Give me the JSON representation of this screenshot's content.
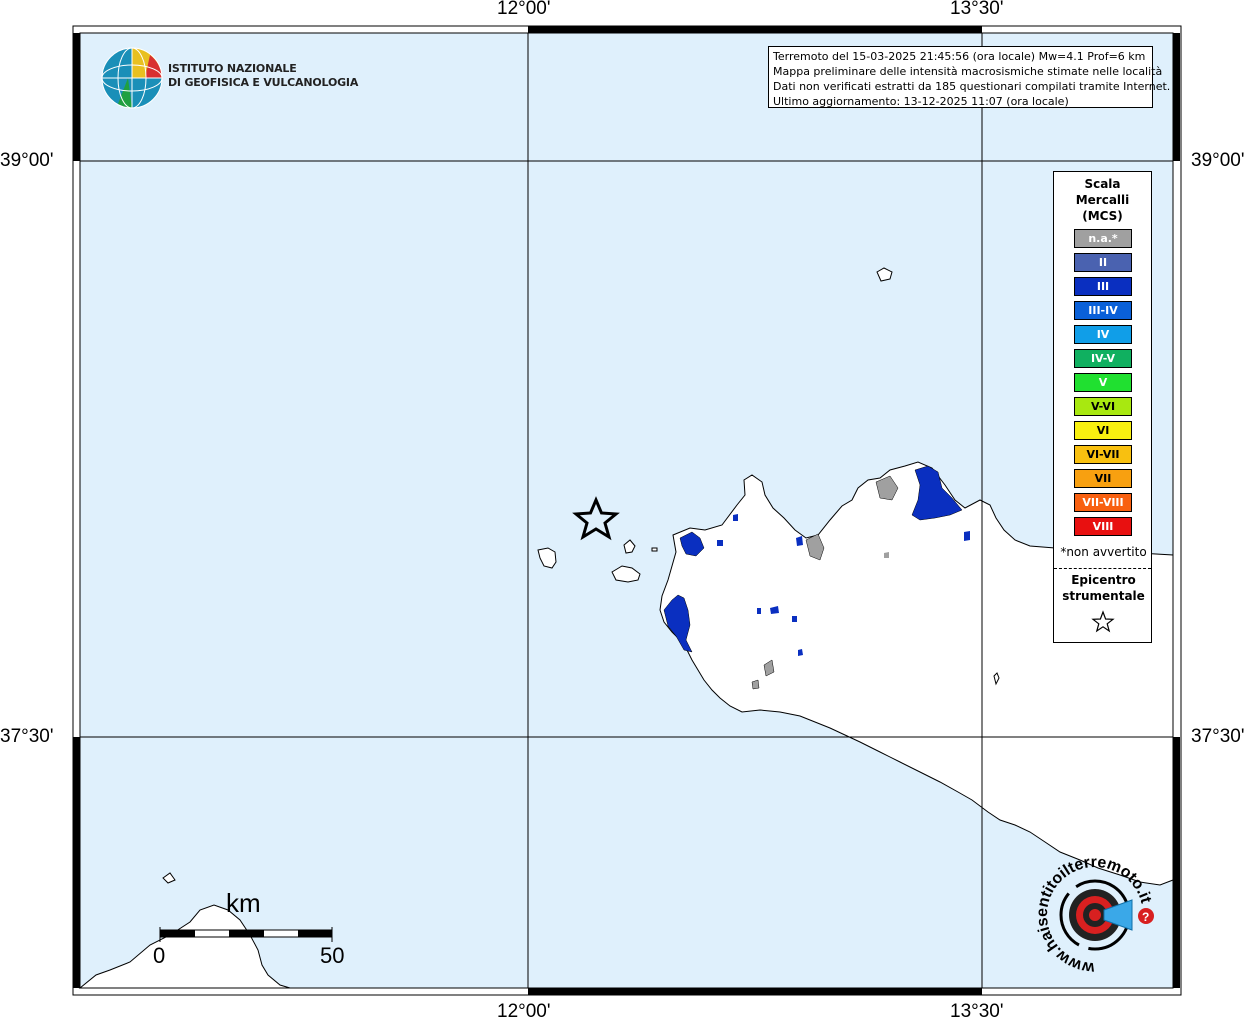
{
  "map": {
    "top_lon_labels": [
      "12°00'",
      "13°30'"
    ],
    "bottom_lon_labels": [
      "12°00'",
      "13°30'"
    ],
    "left_lat_labels": [
      "39°00'",
      "37°30'"
    ],
    "right_lat_labels": [
      "39°00'",
      "37°30'"
    ],
    "sea_color": "#dff0fc",
    "land_color": "#ffffff",
    "epicenter": "star"
  },
  "institute": {
    "line1": "ISTITUTO NAZIONALE",
    "line2": "DI GEOFISICA E VULCANOLOGIA"
  },
  "info": {
    "line1": "Terremoto del 15-03-2025 21:45:56 (ora locale) Mw=4.1 Prof=6 km",
    "line2": "Mappa preliminare delle intensità macrosismiche stimate nelle località",
    "line3": "Dati non verificati estratti da 185 questionari compilati tramite Internet.",
    "line4": "Ultimo aggiornamento: 13-12-2025 11:07 (ora locale)"
  },
  "legend": {
    "title_line1": "Scala",
    "title_line2": "Mercalli",
    "title_line3": "(MCS)",
    "items": [
      {
        "label": "n.a.*",
        "color": "#a0a0a0"
      },
      {
        "label": "II",
        "color": "#4a62b0"
      },
      {
        "label": "III",
        "color": "#0a2fc0"
      },
      {
        "label": "III-IV",
        "color": "#0a60d8"
      },
      {
        "label": "IV",
        "color": "#109ee8"
      },
      {
        "label": "IV-V",
        "color": "#10b060"
      },
      {
        "label": "V",
        "color": "#20e030"
      },
      {
        "label": "V-VI",
        "color": "#a8e810"
      },
      {
        "label": "VI",
        "color": "#f8f010"
      },
      {
        "label": "VI-VII",
        "color": "#f8c010"
      },
      {
        "label": "VII",
        "color": "#f8a010"
      },
      {
        "label": "VII-VIII",
        "color": "#f86010"
      },
      {
        "label": "VIII",
        "color": "#e81010"
      }
    ],
    "note": "*non avvertito",
    "epi_line1": "Epicentro",
    "epi_line2": "strumentale"
  },
  "scale_bar": {
    "unit": "km",
    "start": "0",
    "end": "50"
  },
  "watermark": {
    "text": "www.haisentitoilterremoto.it"
  }
}
